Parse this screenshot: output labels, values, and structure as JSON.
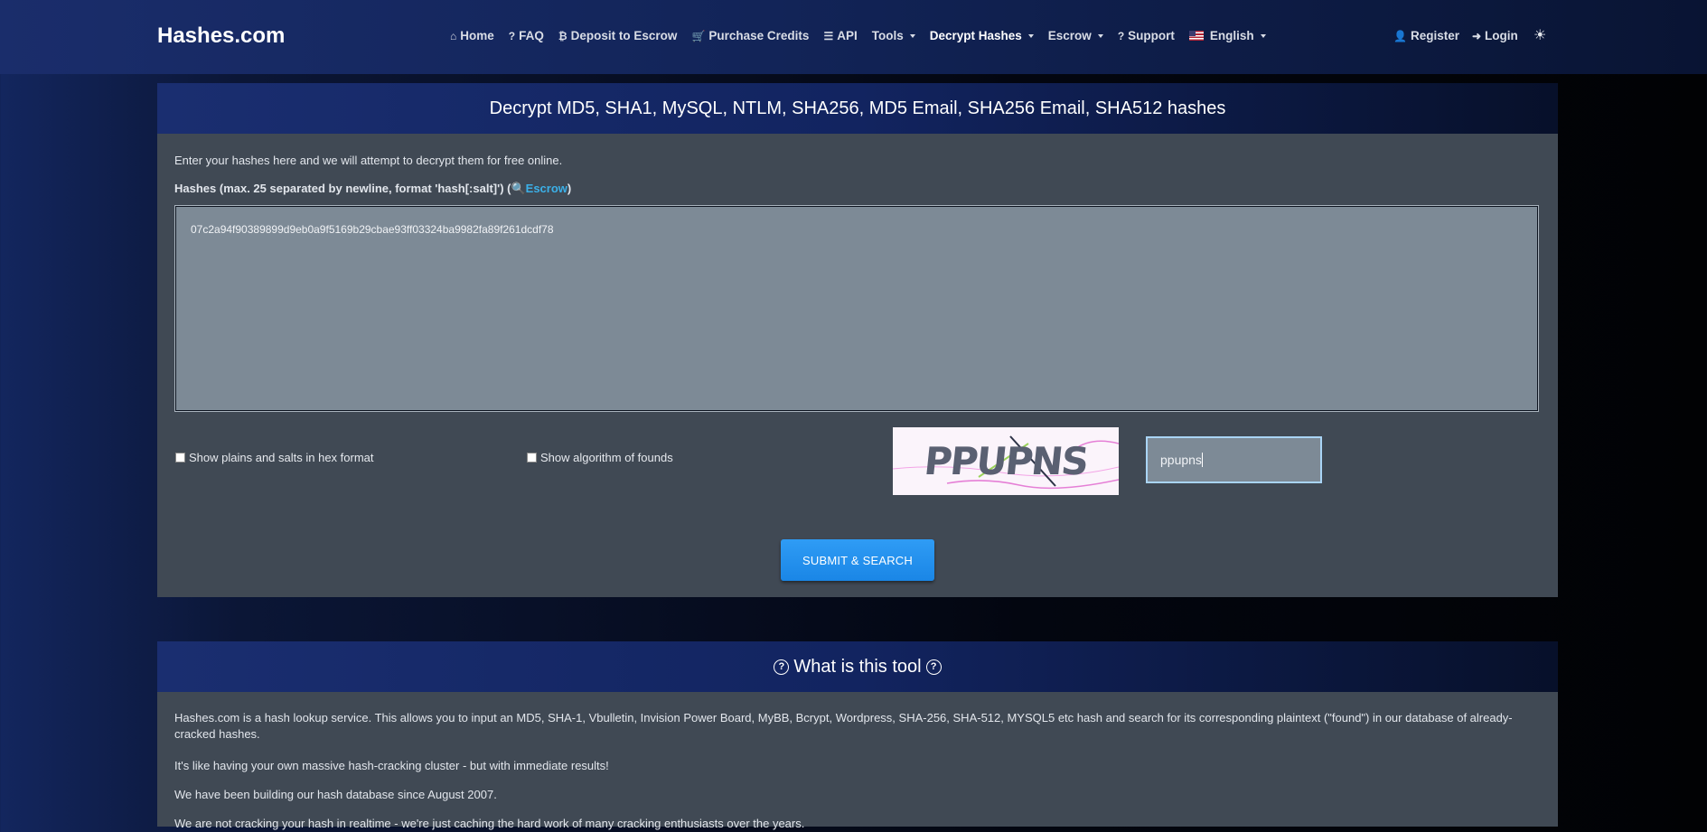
{
  "brand": "Hashes.com",
  "nav": {
    "home": "Home",
    "faq": "FAQ",
    "deposit": "Deposit to Escrow",
    "purchase": "Purchase Credits",
    "api": "API",
    "tools": "Tools",
    "decrypt": "Decrypt Hashes",
    "escrow": "Escrow",
    "support": "Support",
    "language": "English",
    "register": "Register",
    "login": "Login"
  },
  "decrypt_card": {
    "title": "Decrypt MD5, SHA1, MySQL, NTLM, SHA256, MD5 Email, SHA256 Email, SHA512 hashes",
    "intro": "Enter your hashes here and we will attempt to decrypt them for free online.",
    "hash_label": "Hashes (max. 25 separated by newline, format 'hash[:salt]') (",
    "hash_label_link": "Escrow",
    "hash_label_end": ")",
    "hash_value": "07c2a94f90389899d9eb0a9f5169b29cbae93ff03324ba9982fa89f261dcdf78",
    "option_hex": "Show plains and salts in hex format",
    "option_algo": "Show algorithm of founds",
    "captcha_image_text": "PPUPNS",
    "captcha_value": "ppupns",
    "submit": "SUBMIT & SEARCH"
  },
  "info_card": {
    "title": "What is this tool",
    "p1": "Hashes.com is a hash lookup service. This allows you to input an MD5, SHA-1, Vbulletin, Invision Power Board, MyBB, Bcrypt, Wordpress, SHA-256, SHA-512, MYSQL5 etc hash and search for its corresponding plaintext (\"found\") in our database of already-cracked hashes.",
    "p2": "It's like having your own massive hash-cracking cluster - but with immediate results!",
    "p3": "We have been building our hash database since August 2007.",
    "p4": "We are not cracking your hash in realtime - we're just caching the hard work of many cracking enthusiasts over the years."
  }
}
